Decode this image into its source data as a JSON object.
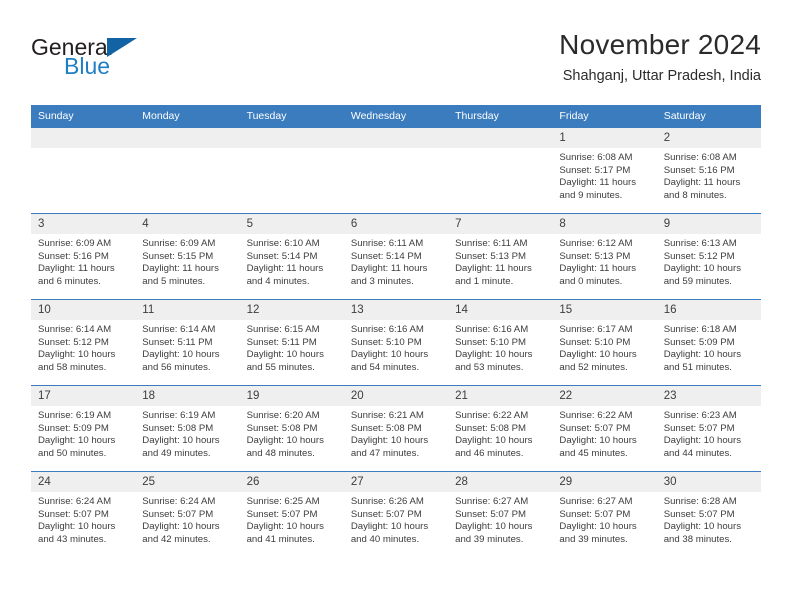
{
  "brand": {
    "name_top": "General",
    "name_bottom": "Blue",
    "accent_color": "#1263a4",
    "text_color": "#231f20"
  },
  "header": {
    "month_title": "November 2024",
    "location": "Shahganj, Uttar Pradesh, India"
  },
  "calendar": {
    "header_color": "#3a7cbe",
    "daynum_band_color": "#efefef",
    "weekdays": [
      "Sunday",
      "Monday",
      "Tuesday",
      "Wednesday",
      "Thursday",
      "Friday",
      "Saturday"
    ],
    "weeks": [
      [
        {
          "day": "",
          "empty": true
        },
        {
          "day": "",
          "empty": true
        },
        {
          "day": "",
          "empty": true
        },
        {
          "day": "",
          "empty": true
        },
        {
          "day": "",
          "empty": true
        },
        {
          "day": "1",
          "sunrise": "Sunrise: 6:08 AM",
          "sunset": "Sunset: 5:17 PM",
          "daylight": "Daylight: 11 hours and 9 minutes."
        },
        {
          "day": "2",
          "sunrise": "Sunrise: 6:08 AM",
          "sunset": "Sunset: 5:16 PM",
          "daylight": "Daylight: 11 hours and 8 minutes."
        }
      ],
      [
        {
          "day": "3",
          "sunrise": "Sunrise: 6:09 AM",
          "sunset": "Sunset: 5:16 PM",
          "daylight": "Daylight: 11 hours and 6 minutes."
        },
        {
          "day": "4",
          "sunrise": "Sunrise: 6:09 AM",
          "sunset": "Sunset: 5:15 PM",
          "daylight": "Daylight: 11 hours and 5 minutes."
        },
        {
          "day": "5",
          "sunrise": "Sunrise: 6:10 AM",
          "sunset": "Sunset: 5:14 PM",
          "daylight": "Daylight: 11 hours and 4 minutes."
        },
        {
          "day": "6",
          "sunrise": "Sunrise: 6:11 AM",
          "sunset": "Sunset: 5:14 PM",
          "daylight": "Daylight: 11 hours and 3 minutes."
        },
        {
          "day": "7",
          "sunrise": "Sunrise: 6:11 AM",
          "sunset": "Sunset: 5:13 PM",
          "daylight": "Daylight: 11 hours and 1 minute."
        },
        {
          "day": "8",
          "sunrise": "Sunrise: 6:12 AM",
          "sunset": "Sunset: 5:13 PM",
          "daylight": "Daylight: 11 hours and 0 minutes."
        },
        {
          "day": "9",
          "sunrise": "Sunrise: 6:13 AM",
          "sunset": "Sunset: 5:12 PM",
          "daylight": "Daylight: 10 hours and 59 minutes."
        }
      ],
      [
        {
          "day": "10",
          "sunrise": "Sunrise: 6:14 AM",
          "sunset": "Sunset: 5:12 PM",
          "daylight": "Daylight: 10 hours and 58 minutes."
        },
        {
          "day": "11",
          "sunrise": "Sunrise: 6:14 AM",
          "sunset": "Sunset: 5:11 PM",
          "daylight": "Daylight: 10 hours and 56 minutes."
        },
        {
          "day": "12",
          "sunrise": "Sunrise: 6:15 AM",
          "sunset": "Sunset: 5:11 PM",
          "daylight": "Daylight: 10 hours and 55 minutes."
        },
        {
          "day": "13",
          "sunrise": "Sunrise: 6:16 AM",
          "sunset": "Sunset: 5:10 PM",
          "daylight": "Daylight: 10 hours and 54 minutes."
        },
        {
          "day": "14",
          "sunrise": "Sunrise: 6:16 AM",
          "sunset": "Sunset: 5:10 PM",
          "daylight": "Daylight: 10 hours and 53 minutes."
        },
        {
          "day": "15",
          "sunrise": "Sunrise: 6:17 AM",
          "sunset": "Sunset: 5:10 PM",
          "daylight": "Daylight: 10 hours and 52 minutes."
        },
        {
          "day": "16",
          "sunrise": "Sunrise: 6:18 AM",
          "sunset": "Sunset: 5:09 PM",
          "daylight": "Daylight: 10 hours and 51 minutes."
        }
      ],
      [
        {
          "day": "17",
          "sunrise": "Sunrise: 6:19 AM",
          "sunset": "Sunset: 5:09 PM",
          "daylight": "Daylight: 10 hours and 50 minutes."
        },
        {
          "day": "18",
          "sunrise": "Sunrise: 6:19 AM",
          "sunset": "Sunset: 5:08 PM",
          "daylight": "Daylight: 10 hours and 49 minutes."
        },
        {
          "day": "19",
          "sunrise": "Sunrise: 6:20 AM",
          "sunset": "Sunset: 5:08 PM",
          "daylight": "Daylight: 10 hours and 48 minutes."
        },
        {
          "day": "20",
          "sunrise": "Sunrise: 6:21 AM",
          "sunset": "Sunset: 5:08 PM",
          "daylight": "Daylight: 10 hours and 47 minutes."
        },
        {
          "day": "21",
          "sunrise": "Sunrise: 6:22 AM",
          "sunset": "Sunset: 5:08 PM",
          "daylight": "Daylight: 10 hours and 46 minutes."
        },
        {
          "day": "22",
          "sunrise": "Sunrise: 6:22 AM",
          "sunset": "Sunset: 5:07 PM",
          "daylight": "Daylight: 10 hours and 45 minutes."
        },
        {
          "day": "23",
          "sunrise": "Sunrise: 6:23 AM",
          "sunset": "Sunset: 5:07 PM",
          "daylight": "Daylight: 10 hours and 44 minutes."
        }
      ],
      [
        {
          "day": "24",
          "sunrise": "Sunrise: 6:24 AM",
          "sunset": "Sunset: 5:07 PM",
          "daylight": "Daylight: 10 hours and 43 minutes."
        },
        {
          "day": "25",
          "sunrise": "Sunrise: 6:24 AM",
          "sunset": "Sunset: 5:07 PM",
          "daylight": "Daylight: 10 hours and 42 minutes."
        },
        {
          "day": "26",
          "sunrise": "Sunrise: 6:25 AM",
          "sunset": "Sunset: 5:07 PM",
          "daylight": "Daylight: 10 hours and 41 minutes."
        },
        {
          "day": "27",
          "sunrise": "Sunrise: 6:26 AM",
          "sunset": "Sunset: 5:07 PM",
          "daylight": "Daylight: 10 hours and 40 minutes."
        },
        {
          "day": "28",
          "sunrise": "Sunrise: 6:27 AM",
          "sunset": "Sunset: 5:07 PM",
          "daylight": "Daylight: 10 hours and 39 minutes."
        },
        {
          "day": "29",
          "sunrise": "Sunrise: 6:27 AM",
          "sunset": "Sunset: 5:07 PM",
          "daylight": "Daylight: 10 hours and 39 minutes."
        },
        {
          "day": "30",
          "sunrise": "Sunrise: 6:28 AM",
          "sunset": "Sunset: 5:07 PM",
          "daylight": "Daylight: 10 hours and 38 minutes."
        }
      ]
    ]
  }
}
